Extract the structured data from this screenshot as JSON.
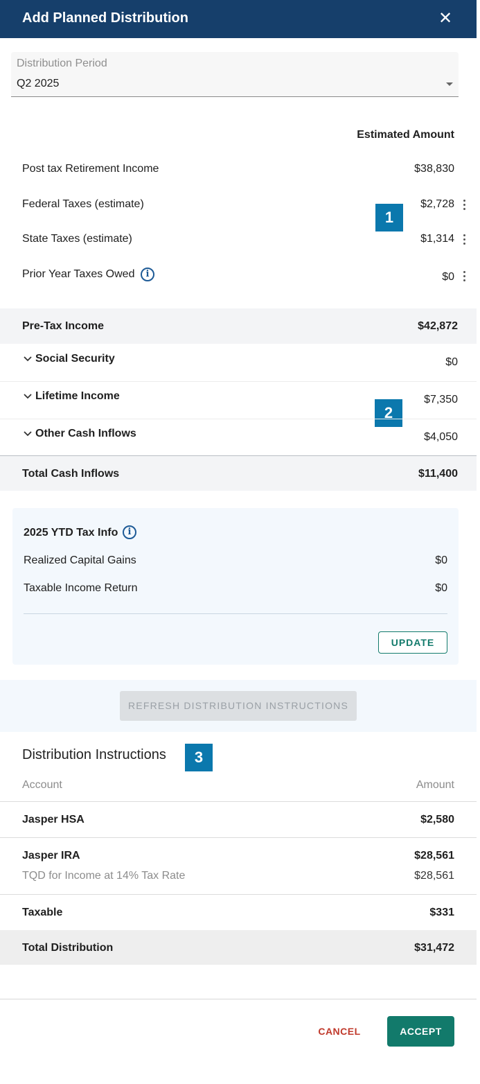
{
  "header": {
    "title": "Add Planned Distribution",
    "close_icon": "close-icon"
  },
  "period": {
    "label": "Distribution Period",
    "value": "Q2 2025"
  },
  "estimates": {
    "column_header": "Estimated Amount",
    "rows": [
      {
        "label": "Post tax Retirement Income",
        "value": "$38,830"
      },
      {
        "label": "Federal Taxes (estimate)",
        "value": "$2,728"
      },
      {
        "label": "State Taxes (estimate)",
        "value": "$1,314"
      },
      {
        "label": "Prior Year Taxes Owed",
        "value": "$0"
      }
    ]
  },
  "badges": [
    "1",
    "2",
    "3"
  ],
  "pretax": {
    "label": "Pre-Tax Income",
    "value": "$42,872"
  },
  "inflows": [
    {
      "label": "Social Security",
      "value": "$0"
    },
    {
      "label": "Lifetime Income",
      "value": "$7,350"
    },
    {
      "label": "Other Cash Inflows",
      "value": "$4,050"
    }
  ],
  "total_inflows": {
    "label": "Total Cash Inflows",
    "value": "$11,400"
  },
  "ytd": {
    "title": "2025 YTD Tax Info",
    "rows": [
      {
        "label": "Realized Capital Gains",
        "value": "$0"
      },
      {
        "label": "Taxable Income Return",
        "value": "$0"
      }
    ],
    "update_label": "UPDATE"
  },
  "refresh_label": "REFRESH DISTRIBUTION INSTRUCTIONS",
  "instructions": {
    "title": "Distribution Instructions",
    "col_account": "Account",
    "col_amount": "Amount",
    "rows": [
      {
        "account": "Jasper HSA",
        "amount": "$2,580"
      },
      {
        "account": "Jasper IRA",
        "amount": "$28,561",
        "sub_label": "TQD for Income at 14% Tax Rate",
        "sub_amount": "$28,561"
      },
      {
        "account": "Taxable",
        "amount": "$331"
      }
    ],
    "total_label": "Total Distribution",
    "total_value": "$31,472"
  },
  "footer": {
    "cancel": "CANCEL",
    "accept": "ACCEPT"
  },
  "colors": {
    "header": "#163f6b",
    "badge": "#0b78ad",
    "accept": "#127a6b",
    "cancel": "#c0392b"
  }
}
